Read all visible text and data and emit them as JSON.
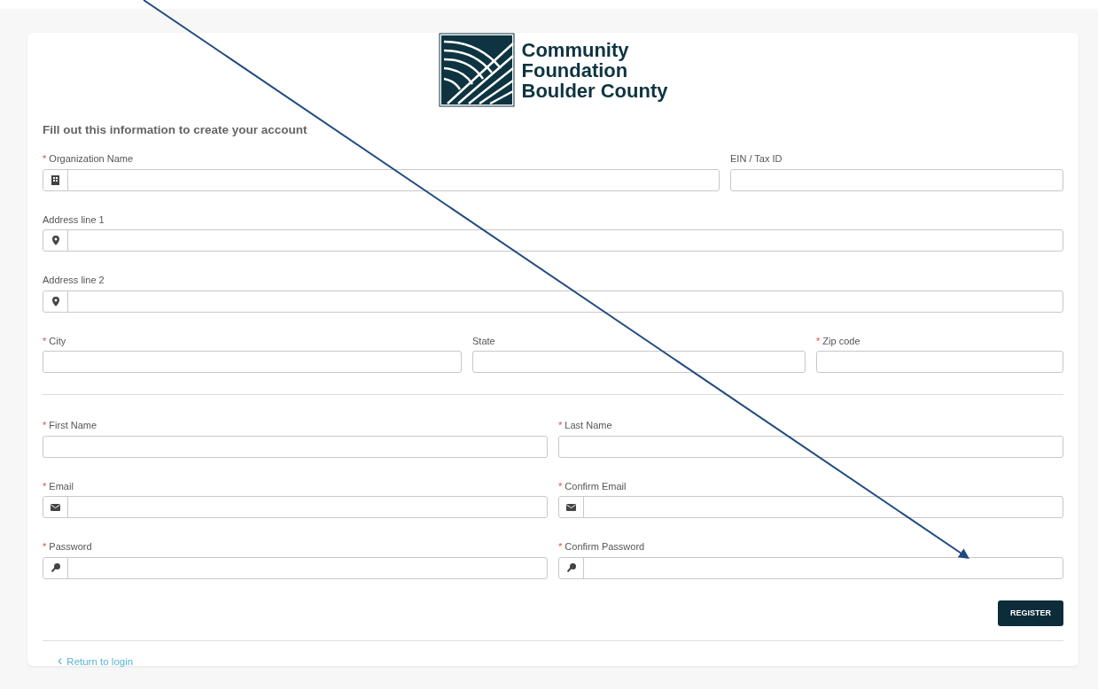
{
  "logo": {
    "lines": [
      "Community",
      "Foundation",
      "Boulder County"
    ]
  },
  "heading": "Fill out this information to create your account",
  "groups": [
    {
      "rows": [
        [
          {
            "label": "Organization Name",
            "required": true,
            "kind": "organization"
          },
          {
            "label": "EIN / Tax ID",
            "required": false,
            "kind": "text"
          }
        ],
        [
          {
            "label": "Address line 1",
            "required": false,
            "kind": "address"
          }
        ],
        [
          {
            "label": "Address line 2",
            "required": false,
            "kind": "address"
          }
        ],
        [
          {
            "label": "City",
            "required": true,
            "kind": "text"
          },
          {
            "label": "State",
            "required": false,
            "kind": "text"
          },
          {
            "label": "Zip code",
            "required": true,
            "kind": "text"
          }
        ]
      ]
    },
    {
      "rows": [
        [
          {
            "label": "First Name",
            "required": true,
            "kind": "text"
          },
          {
            "label": "Last Name",
            "required": true,
            "kind": "text"
          }
        ],
        [
          {
            "label": "Email",
            "required": true,
            "kind": "email"
          },
          {
            "label": "Confirm Email",
            "required": true,
            "kind": "email"
          }
        ],
        [
          {
            "label": "Password",
            "required": true,
            "kind": "password"
          },
          {
            "label": "Confirm Password",
            "required": true,
            "kind": "password"
          }
        ]
      ]
    }
  ],
  "required_mark": "*",
  "submit": "REGISTER",
  "back_link": {
    "icon": "‹",
    "label": "Return to login"
  }
}
